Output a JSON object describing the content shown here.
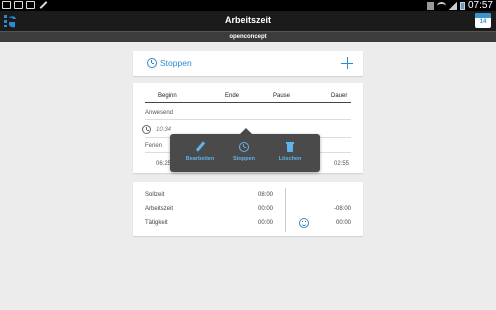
{
  "status_bar": {
    "time": "07:57"
  },
  "action_bar": {
    "title": "Arbeitszeit",
    "calendar_label": "14"
  },
  "sub_bar": {
    "account": "openconcept"
  },
  "card_stop": {
    "label": "Stoppen"
  },
  "table": {
    "headers": {
      "begin": "Beginn",
      "end": "Ende",
      "pause": "Pause",
      "duration": "Dauer"
    },
    "sections": [
      {
        "title": "Anwesend",
        "time_start": "10:34"
      },
      {
        "title": "Ferien",
        "begin": "06:25",
        "duration": "02:55"
      }
    ]
  },
  "popup": {
    "edit_label": "Bearbeiten",
    "stop_label": "Stoppen",
    "delete_label": "Löschen"
  },
  "summary": {
    "rows": [
      {
        "label": "Sollzeit",
        "value": "08:00"
      },
      {
        "label": "Arbeitszeit",
        "value": "00:00"
      },
      {
        "label": "Tätigkeit",
        "value": "00:00"
      }
    ],
    "balance_top": "-08:00",
    "balance_bottom": "00:00"
  },
  "colors": {
    "accent": "#2a8bd0",
    "popup_bg": "#4a4a4a",
    "actionbar_bg": "#1b1b1b"
  }
}
